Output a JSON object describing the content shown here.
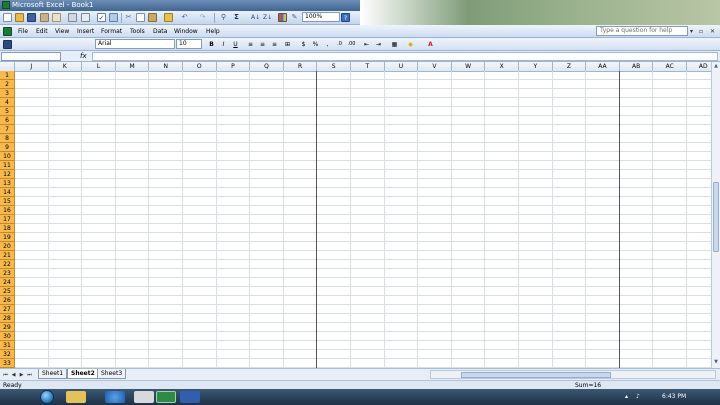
{
  "window": {
    "title": "Microsoft Excel - Book1"
  },
  "menu": {
    "items": [
      "File",
      "Edit",
      "View",
      "Insert",
      "Format",
      "Tools",
      "Data",
      "Window",
      "Help"
    ],
    "help_placeholder": "Type a question for help"
  },
  "toolbar": {
    "zoom": "100%",
    "font_name": "Arial",
    "font_size": "10",
    "bold": "B",
    "italic": "I",
    "underline": "U",
    "currency": "$",
    "percent": "%",
    "sum": "Σ"
  },
  "formula_bar": {
    "fx_label": "fx",
    "name_box": "",
    "content": ""
  },
  "grid": {
    "columns": [
      "J",
      "K",
      "L",
      "M",
      "N",
      "O",
      "P",
      "Q",
      "R",
      "S",
      "T",
      "U",
      "V",
      "W",
      "X",
      "Y",
      "Z",
      "AA",
      "AB",
      "AC",
      "AD"
    ],
    "rows": [
      "1",
      "2",
      "3",
      "4",
      "5",
      "6",
      "7",
      "8",
      "9",
      "10",
      "11",
      "12",
      "13",
      "14",
      "15",
      "16",
      "17",
      "18",
      "19",
      "20",
      "21",
      "22",
      "23",
      "24",
      "25",
      "26",
      "27",
      "28",
      "29",
      "30",
      "31",
      "32",
      "33"
    ]
  },
  "sheets": {
    "tabs": [
      "Sheet1",
      "Sheet2",
      "Sheet3"
    ],
    "active": "Sheet2"
  },
  "status": {
    "left": "Ready",
    "sum": "Sum=16"
  },
  "taskbar": {
    "clock": "6:43 PM"
  },
  "colors": {
    "row_header_selected": "#f7b84d",
    "title_bar": "#3f6593",
    "toolbar": "#cddcf0",
    "excel_green": "#1f7a3a"
  },
  "icons": [
    "new-icon",
    "open-icon",
    "save-icon",
    "permission-icon",
    "email-icon",
    "print-icon",
    "print-preview-icon",
    "spelling-icon",
    "research-icon",
    "cut-icon",
    "copy-icon",
    "paste-icon",
    "format-painter-icon",
    "undo-icon",
    "redo-icon",
    "hyperlink-icon",
    "autosum-icon",
    "sort-asc-icon",
    "sort-desc-icon",
    "chart-icon",
    "drawing-icon",
    "help-icon"
  ]
}
